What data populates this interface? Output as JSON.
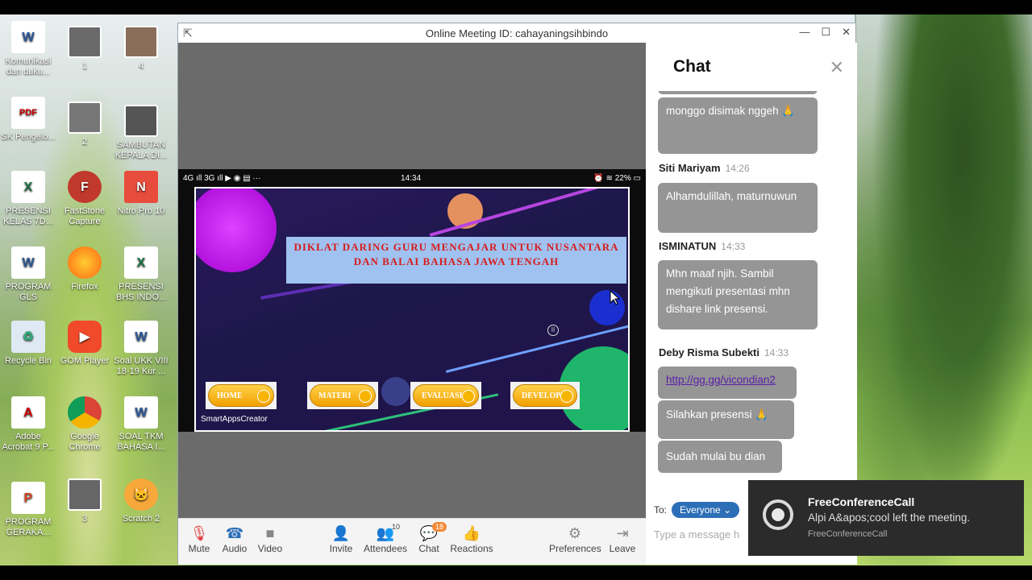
{
  "window": {
    "title": "Online Meeting ID: cahayaningsihbindo"
  },
  "desktop_icons": [
    {
      "label": "Komunikasi dan duku...",
      "icon": "word-icon"
    },
    {
      "label": "1",
      "icon": "image-icon"
    },
    {
      "label": "4",
      "icon": "image-icon"
    },
    {
      "label": "SK Pengelo...",
      "icon": "pdf-icon"
    },
    {
      "label": "2",
      "icon": "image-icon"
    },
    {
      "label": "SAMBUTAN KEPALA DI...",
      "icon": "video-icon"
    },
    {
      "label": "PRESENSI KELAS 7D...",
      "icon": "excel-icon"
    },
    {
      "label": "FastStone Capture",
      "icon": "faststone-icon"
    },
    {
      "label": "Nitro Pro 10",
      "icon": "nitro-icon"
    },
    {
      "label": "PROGRAM GLS",
      "icon": "word-icon"
    },
    {
      "label": "Firefox",
      "icon": "firefox-icon"
    },
    {
      "label": "PRESENSI BHS INDO...",
      "icon": "excel-icon"
    },
    {
      "label": "Recycle Bin",
      "icon": "recycle-bin-icon"
    },
    {
      "label": "GOM Player",
      "icon": "gom-player-icon"
    },
    {
      "label": "Soal UKK VIII 18-19 Kur ...",
      "icon": "word-icon"
    },
    {
      "label": "Adobe Acrobat 9 P...",
      "icon": "acrobat-icon"
    },
    {
      "label": "Google Chrome",
      "icon": "chrome-icon"
    },
    {
      "label": "SOAL TKM BAHASA I...",
      "icon": "word-icon"
    },
    {
      "label": "PROGRAM GERAKA...",
      "icon": "powerpoint-icon"
    },
    {
      "label": "3",
      "icon": "image-icon"
    },
    {
      "label": "Scratch 2",
      "icon": "scratch-icon"
    }
  ],
  "phone": {
    "status_left": "4G ıll 3G ıll ▶ ◉ ▤ ···",
    "time": "14:34",
    "status_right": "⏰ ≋ 22% ▭"
  },
  "slide": {
    "title": "DIKLAT DARING GURU MENGAJAR UNTUK NUSANTARA DAN BALAI BAHASA JAWA TENGAH",
    "buttons": [
      "HOME",
      "MATERI",
      "EVALUASI",
      "DEVELOPER"
    ],
    "credit": "SmartAppsCreator"
  },
  "toolbar": {
    "mute": "Mute",
    "audio": "Audio",
    "video": "Video",
    "invite": "Invite",
    "attendees": "Attendees",
    "attendees_count": "10",
    "chat": "Chat",
    "chat_count": "18",
    "reactions": "Reactions",
    "preferences": "Preferences",
    "leave": "Leave"
  },
  "chat": {
    "title": "Chat",
    "messages": [
      {
        "text": "monggo disimak nggeh 🙏"
      },
      {
        "sender": "Siti Mariyam",
        "time": "14:26",
        "text": "Alhamdulillah, maturnuwun"
      },
      {
        "sender": "ISMINATUN",
        "time": "14:33",
        "text": "Mhn maaf njih. Sambil mengikuti presentasi mhn dishare link presensi."
      },
      {
        "sender": "Deby Risma Subekti",
        "time": "14:33",
        "link": "http://gg.gg/vicondian2"
      },
      {
        "text": "Silahkan presensi 🙏"
      },
      {
        "text": "Sudah mulai bu dian"
      }
    ],
    "to_label": "To:",
    "recipient": "Everyone",
    "input_placeholder": "Type a message h"
  },
  "notification": {
    "title": "FreeConferenceCall",
    "message": "Alpi A&apos;cool left the meeting.",
    "source": "FreeConferenceCall"
  }
}
